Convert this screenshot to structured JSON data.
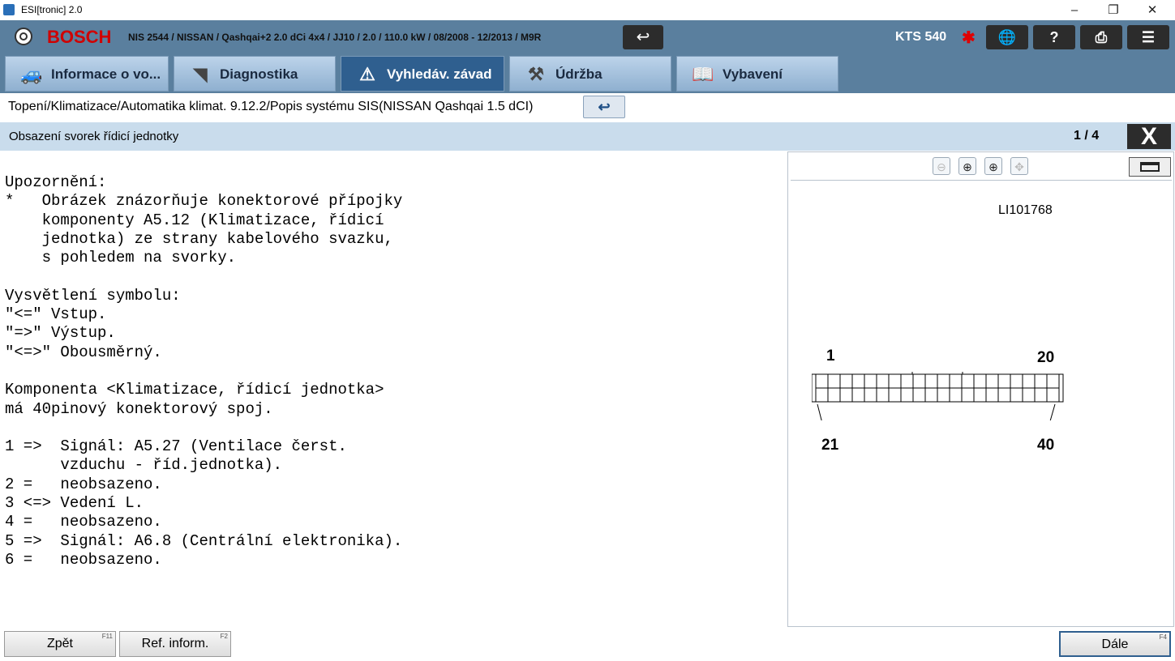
{
  "window": {
    "title": "ESI[tronic] 2.0",
    "controls": {
      "minimize": "–",
      "maximize": "❐",
      "close": "✕"
    }
  },
  "header": {
    "brand": "BOSCH",
    "vehicle": "NIS 2544 / NISSAN / Qashqai+2 2.0 dCi 4x4 / JJ10 / 2.0 / 110.0 kW / 08/2008 - 12/2013 / M9R",
    "back_icon": "↩",
    "device": "KTS 540",
    "bluetooth_icon": "bluetooth-icon",
    "buttons": [
      {
        "name": "globe-offline-icon",
        "glyph": "🌐"
      },
      {
        "name": "help-icon",
        "glyph": "?"
      },
      {
        "name": "print-icon",
        "glyph": "⎙"
      },
      {
        "name": "notes-icon",
        "glyph": "☰"
      }
    ],
    "accent": "#d00000"
  },
  "tabs": [
    {
      "label": "Informace o vo...",
      "icon": "car-info-icon",
      "glyph": "🚙",
      "active": false
    },
    {
      "label": "Diagnostika",
      "icon": "tester-icon",
      "glyph": "◥",
      "active": false
    },
    {
      "label": "Vyhledáv. závad",
      "icon": "search-fault-icon",
      "glyph": "⚠",
      "active": true
    },
    {
      "label": "Údržba",
      "icon": "maintenance-icon",
      "glyph": "⚒",
      "active": false
    },
    {
      "label": "Vybavení",
      "icon": "book-icon",
      "glyph": "📖",
      "active": false
    }
  ],
  "breadcrumb": {
    "text": "Topení/Klimatizace/Automatika klimat. 9.12.2/Popis systému SIS(NISSAN Qashqai 1.5 dCI)",
    "back_icon": "↩"
  },
  "section": {
    "title": "Obsazení svorek řídicí jednotky",
    "page": "1 / 4",
    "close_label": "X"
  },
  "content": {
    "lines": [
      "Upozornění:",
      "*   Obrázek znázorňuje konektorové přípojky",
      "    komponenty A5.12 (Klimatizace, řídicí",
      "    jednotka) ze strany kabelového svazku,",
      "    s pohledem na svorky.",
      "",
      "Vysvětlení symbolu:",
      "\"<=\" Vstup.",
      "\"=>\" Výstup.",
      "\"<=>\" Obousměrný.",
      "",
      "Komponenta <Klimatizace, řídicí jednotka>",
      "má 40pinový konektorový spoj.",
      "",
      "1 =>  Signál: A5.27 (Ventilace čerst.",
      "      vzduchu - říd.jednotka).",
      "2 =   neobsazeno.",
      "3 <=> Vedení L.",
      "4 =   neobsazeno.",
      "5 =>  Signál: A6.8 (Centrální elektronika).",
      "6 =   neobsazeno."
    ]
  },
  "viewer": {
    "tools": [
      {
        "name": "zoom-out-icon",
        "glyph": "⊖",
        "enabled": false
      },
      {
        "name": "zoom-in-icon",
        "glyph": "⊕",
        "enabled": true
      },
      {
        "name": "zoom-area-icon",
        "glyph": "⊕",
        "enabled": true
      },
      {
        "name": "pan-icon",
        "glyph": "✥",
        "enabled": false
      }
    ],
    "image_id": "LI101768",
    "pins": {
      "top_left": "1",
      "top_right": "20",
      "bottom_left": "21",
      "bottom_right": "40"
    }
  },
  "footer": {
    "back": {
      "label": "Zpět",
      "key": "F11"
    },
    "ref": {
      "label": "Ref. inform.",
      "key": "F2"
    },
    "next": {
      "label": "Dále",
      "key": "F4"
    }
  }
}
